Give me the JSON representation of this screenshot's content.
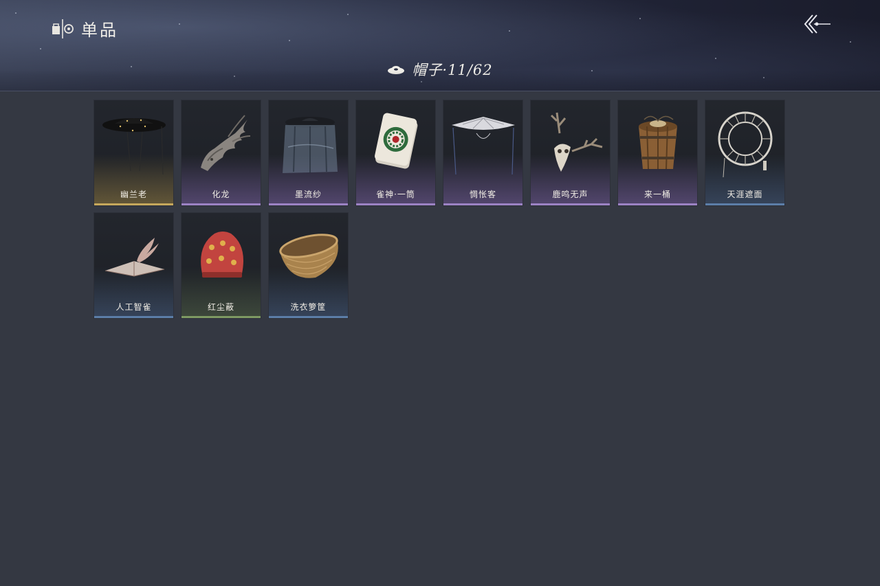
{
  "header": {
    "title": "单品",
    "title_icon": "shop-icon",
    "back_icon": "back-arrow-icon"
  },
  "category": {
    "icon": "hat-icon",
    "label": "帽子·11/62"
  },
  "rarity_colors": {
    "gold": "#c6a85c",
    "purple": "#9c83c4",
    "blue": "#5c7ea8",
    "green": "#7e9a63"
  },
  "items": [
    {
      "name": "幽兰老",
      "rarity": "gold",
      "icon": "black-hat-icon"
    },
    {
      "name": "化龙",
      "rarity": "purple",
      "icon": "dragon-head-icon"
    },
    {
      "name": "墨流纱",
      "rarity": "purple",
      "icon": "veiled-hat-icon"
    },
    {
      "name": "雀神·一筒",
      "rarity": "purple",
      "icon": "mahjong-tile-icon"
    },
    {
      "name": "惆怅客",
      "rarity": "purple",
      "icon": "white-veil-hat-icon"
    },
    {
      "name": "鹿鸣无声",
      "rarity": "purple",
      "icon": "deer-skull-icon"
    },
    {
      "name": "来一桶",
      "rarity": "purple",
      "icon": "wooden-bucket-icon"
    },
    {
      "name": "天涯遮面",
      "rarity": "blue",
      "icon": "wheel-hat-icon"
    },
    {
      "name": "人工智雀",
      "rarity": "blue",
      "icon": "paper-bird-hat-icon"
    },
    {
      "name": "红尘蔽",
      "rarity": "green",
      "icon": "red-hood-icon"
    },
    {
      "name": "洗衣箩筐",
      "rarity": "blue",
      "icon": "basket-icon"
    }
  ]
}
